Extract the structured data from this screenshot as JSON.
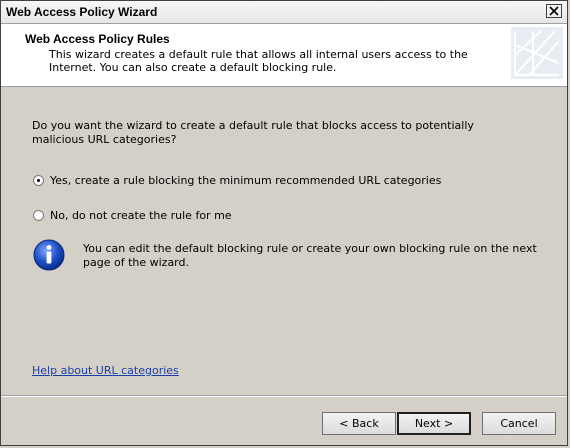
{
  "window": {
    "title": "Web Access Policy Wizard"
  },
  "header": {
    "title": "Web Access Policy Rules",
    "description": "This wizard creates a default rule that allows all internal users access to the Internet. You can also create a default blocking rule."
  },
  "main": {
    "question": "Do you want the wizard to create a default rule that blocks access to potentially malicious URL categories?",
    "options": [
      {
        "label": "Yes, create a rule blocking the minimum recommended URL categories",
        "selected": true
      },
      {
        "label": "No, do not create the rule for me",
        "selected": false
      }
    ],
    "info_text": "You can edit the default blocking rule or create your own blocking rule on the next page of the wizard.",
    "help_link": "Help about URL categories"
  },
  "buttons": {
    "back": "< Back",
    "next": "Next >",
    "cancel": "Cancel"
  },
  "icons": {
    "close": "close-icon",
    "info": "info-icon",
    "logo": "wizard-logo-icon"
  }
}
